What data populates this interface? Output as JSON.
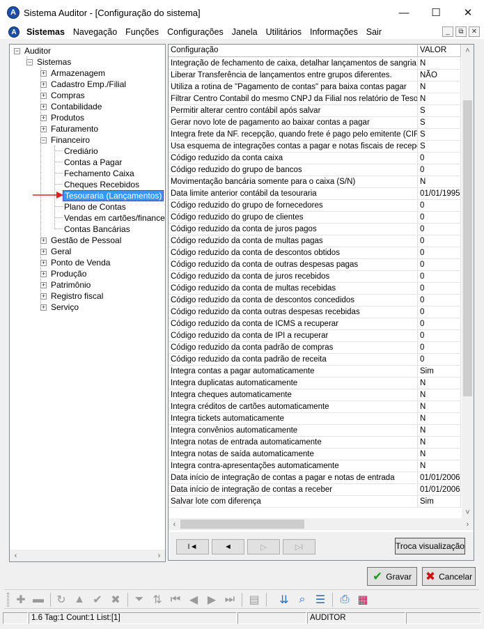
{
  "window": {
    "app_icon": "A",
    "title": "Sistema Auditor - [Configuração do sistema]"
  },
  "menu": {
    "items": [
      "Sistemas",
      "Navegação",
      "Funções",
      "Configurações",
      "Janela",
      "Utilitários",
      "Informações",
      "Sair"
    ]
  },
  "tree": {
    "root": "Auditor",
    "sistemas": "Sistemas",
    "groups": [
      "Armazenagem",
      "Cadastro Emp./Filial",
      "Compras",
      "Contabilidade",
      "Produtos",
      "Faturamento",
      "Financeiro"
    ],
    "financeiro_children": [
      "Crediário",
      "Contas a Pagar",
      "Fechamento Caixa",
      "Cheques Recebidos",
      "Tesouraria (Lançamentos)",
      "Plano de Contas",
      "Vendas em cartões/financeiras",
      "Contas Bancárias"
    ],
    "selected": "Tesouraria (Lançamentos)",
    "groups_after": [
      "Gestão de Pessoal",
      "Geral",
      "Ponto de Venda",
      "Produção",
      "Patrimônio",
      "Registro fiscal",
      "Serviço"
    ]
  },
  "grid": {
    "headers": [
      "Configuração",
      "VALOR"
    ],
    "rows": [
      [
        "Integração de fechamento de caixa, detalhar lançamentos de sangria",
        "N"
      ],
      [
        "Liberar Transferência de lançamentos entre grupos diferentes.",
        "NÃO"
      ],
      [
        "Utiliza a rotina de \"Pagamento de contas\" para baixa contas pagar",
        "N"
      ],
      [
        "Filtrar Centro Contabil do mesmo CNPJ da Filial nos relatório de Tesouraria.",
        "N"
      ],
      [
        "Permitir alterar centro contábil após salvar",
        "S"
      ],
      [
        "Gerar novo lote de pagamento ao baixar contas a pagar",
        "S"
      ],
      [
        "Integra frete da NF. recepção, quando frete é pago pelo emitente (CIF)",
        "S"
      ],
      [
        "Usa esquema de integrações contas a pagar e notas fiscais de recepção",
        "S"
      ],
      [
        "Código reduzido da conta caixa",
        "0"
      ],
      [
        "Código reduzido do grupo de bancos",
        "0"
      ],
      [
        "Movimentação bancária somente para o caixa (S/N)",
        "N"
      ],
      [
        "Data limite anterior contábil da tesouraria",
        "01/01/1995"
      ],
      [
        "Código reduzido do grupo de fornecedores",
        "0"
      ],
      [
        "Código reduzido do grupo de clientes",
        "0"
      ],
      [
        "Código reduzido da conta de juros pagos",
        "0"
      ],
      [
        "Código reduzido da conta de multas pagas",
        "0"
      ],
      [
        "Código reduzido da conta de descontos obtidos",
        "0"
      ],
      [
        "Código reduzido da conta de outras despesas pagas",
        "0"
      ],
      [
        "Código reduzido da conta de juros recebidos",
        "0"
      ],
      [
        "Código reduzido da conta de multas recebidas",
        "0"
      ],
      [
        "Código reduzido da conta de descontos concedidos",
        "0"
      ],
      [
        "Código reduzido da conta outras despesas recebidas",
        "0"
      ],
      [
        "Código reduzido da conta de ICMS a recuperar",
        "0"
      ],
      [
        "Código reduzido da conta de IPI a recuperar",
        "0"
      ],
      [
        "Código reduzido da conta padrão de compras",
        "0"
      ],
      [
        "Código reduzido da conta padrão de receita",
        "0"
      ],
      [
        "Integra contas a pagar automaticamente",
        "Sim"
      ],
      [
        "Integra duplicatas automaticamente",
        "N"
      ],
      [
        "Integra cheques automaticamente",
        "N"
      ],
      [
        "Integra créditos de cartões automaticamente",
        "N"
      ],
      [
        "Integra tickets automaticamente",
        "N"
      ],
      [
        "Integra convênios automaticamente",
        "N"
      ],
      [
        "Integra notas de entrada automaticamente",
        "N"
      ],
      [
        "Integra notas de saída automaticamente",
        "N"
      ],
      [
        "Integra contra-apresentações automaticamente",
        "N"
      ],
      [
        "Data início de integração de contas a pagar e notas de entrada",
        "01/01/2006"
      ],
      [
        "Data início de integração de contas a receber",
        "01/01/2006"
      ],
      [
        "Salvar lote com diferença",
        "Sim"
      ]
    ]
  },
  "navigator": {
    "first": "I◄",
    "prev": "◄",
    "next": "▷",
    "last": "▷I",
    "troca_label": "Troca visualização"
  },
  "actions": {
    "save_label": "Gravar",
    "cancel_label": "Cancelar"
  },
  "status": {
    "panel1": "",
    "panel2": "1.6 Tag:1 Count:1 List:[1]",
    "panel3": "",
    "panel4": "AUDITOR",
    "panel5": ""
  },
  "colors": {
    "selection": "#3399ff",
    "save_check": "#1a9a1a",
    "cancel_x": "#d01010",
    "annotation_arrow": "#e02020"
  }
}
